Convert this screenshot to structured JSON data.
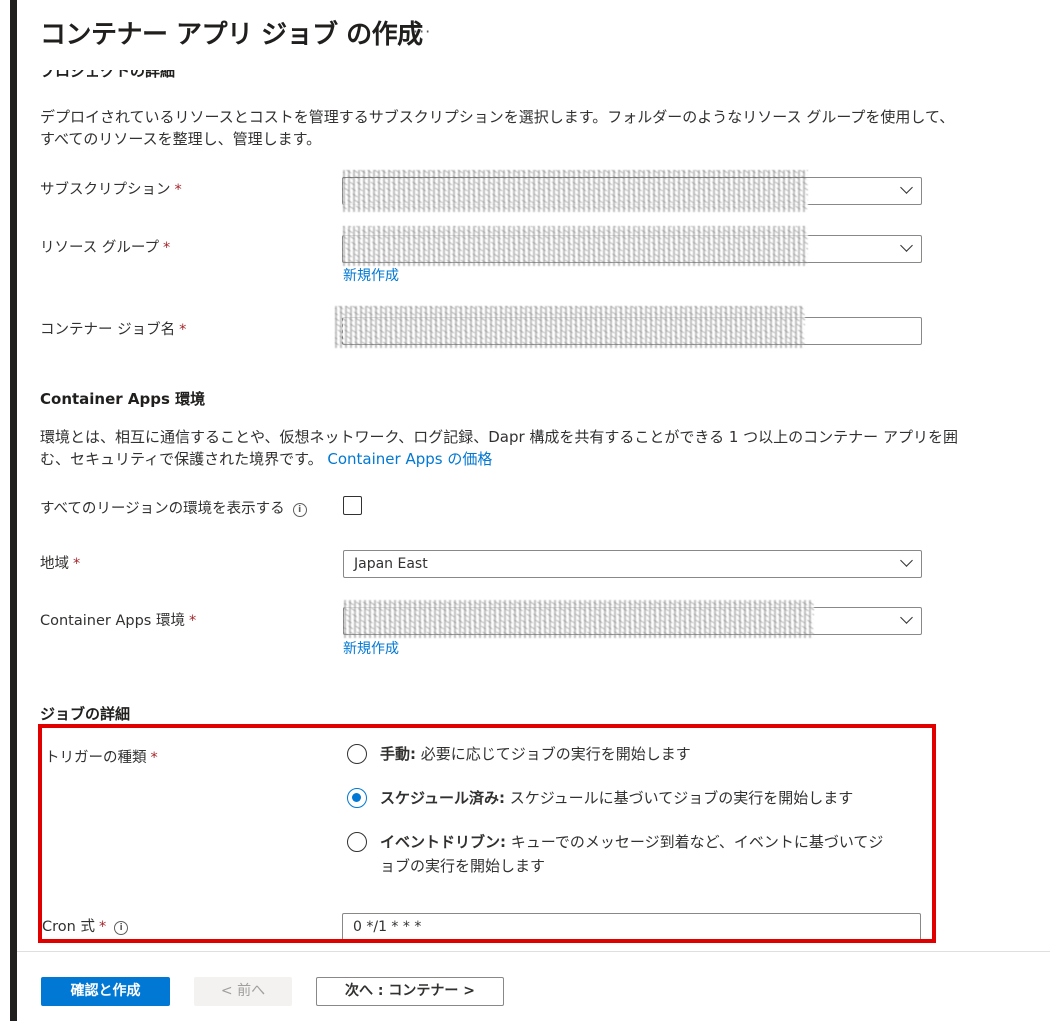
{
  "header": {
    "title": "コンテナー アプリ ジョブ の作成",
    "more_label": "···"
  },
  "project": {
    "heading": "プロジェクトの詳細",
    "description_line1": "デプロイされているリソースとコストを管理するサブスクリプションを選択します。フォルダーのようなリソース グループを使用して、",
    "description_line2": "すべてのリソースを整理し、管理します。",
    "subscription_label": "サブスクリプション",
    "resource_group_label": "リソース グループ",
    "create_new_link": "新規作成",
    "job_name_label": "コンテナー ジョブ名"
  },
  "environment": {
    "heading": "Container Apps 環境",
    "description_line1": "環境とは、相互に通信することや、仮想ネットワーク、ログ記録、Dapr 構成を共有することができる 1 つ以上のコンテナー アプリを囲",
    "description_line2": "む、セキュリティで保護された境界です。",
    "pricing_link": "Container Apps の価格",
    "show_all_regions_label": "すべてのリージョンの環境を表示する",
    "region_label": "地域",
    "region_value": "Japan East",
    "env_label": "Container Apps 環境",
    "create_new_link": "新規作成"
  },
  "job": {
    "heading": "ジョブの詳細",
    "trigger_label": "トリガーの種類",
    "options": [
      {
        "title": "手動:",
        "desc": "必要に応じてジョブの実行を開始します",
        "selected": false
      },
      {
        "title": "スケジュール済み:",
        "desc": "スケジュールに基づいてジョブの実行を開始します",
        "selected": true
      },
      {
        "title": "イベントドリブン:",
        "desc": "キューでのメッセージ到着など、イベントに基づいてジ",
        "desc2": "ョブの実行を開始します",
        "selected": false
      }
    ],
    "cron_label": "Cron 式",
    "cron_value": "0 */1 * * *"
  },
  "required_mark": "*",
  "info_glyph": "i",
  "footer": {
    "review_create": "確認と作成",
    "previous": "< 前へ",
    "next": "次へ : コンテナー >"
  },
  "colors": {
    "accent": "#0078d4",
    "highlight_box": "#e00000",
    "required": "#a4262c"
  }
}
